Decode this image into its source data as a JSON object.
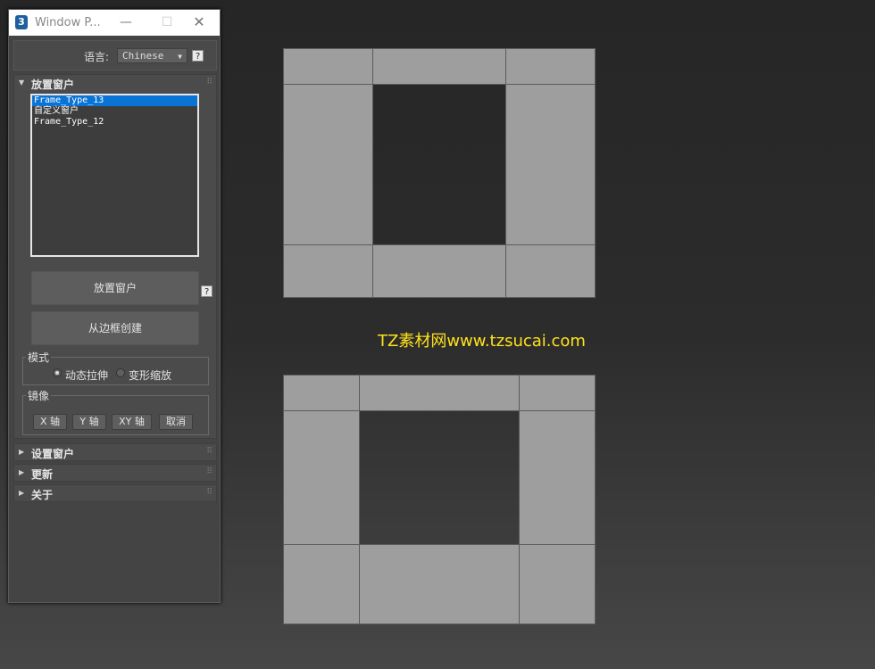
{
  "window": {
    "title": "Window P...",
    "app_icon": "3",
    "min_glyph": "—",
    "max_glyph": "☐",
    "close_glyph": "✕"
  },
  "language": {
    "label": "语言:",
    "value": "Chinese",
    "help": "?"
  },
  "place_rollout": {
    "title": "放置窗户",
    "list_items": [
      "Frame_Type_13",
      "自定义窗户",
      "Frame_Type_12"
    ],
    "selected_index": 0,
    "place_button": "放置窗户",
    "place_help": "?",
    "create_button": "从边框创建",
    "mode": {
      "label": "模式",
      "options": [
        "动态拉伸",
        "变形缩放"
      ],
      "selected": "动态拉伸"
    },
    "mirror": {
      "label": "镜像",
      "buttons": [
        "X 轴",
        "Y 轴",
        "XY 轴",
        "取消"
      ]
    }
  },
  "rollouts": [
    {
      "title": "设置窗户"
    },
    {
      "title": "更新"
    },
    {
      "title": "关于"
    }
  ],
  "watermark": "TZ素材网www.tzsucai.com",
  "colors": {
    "panel": "#4b4b4b",
    "selection": "#0a74d6",
    "cell": "#9d9e9d",
    "watermark": "#ffe21a"
  }
}
